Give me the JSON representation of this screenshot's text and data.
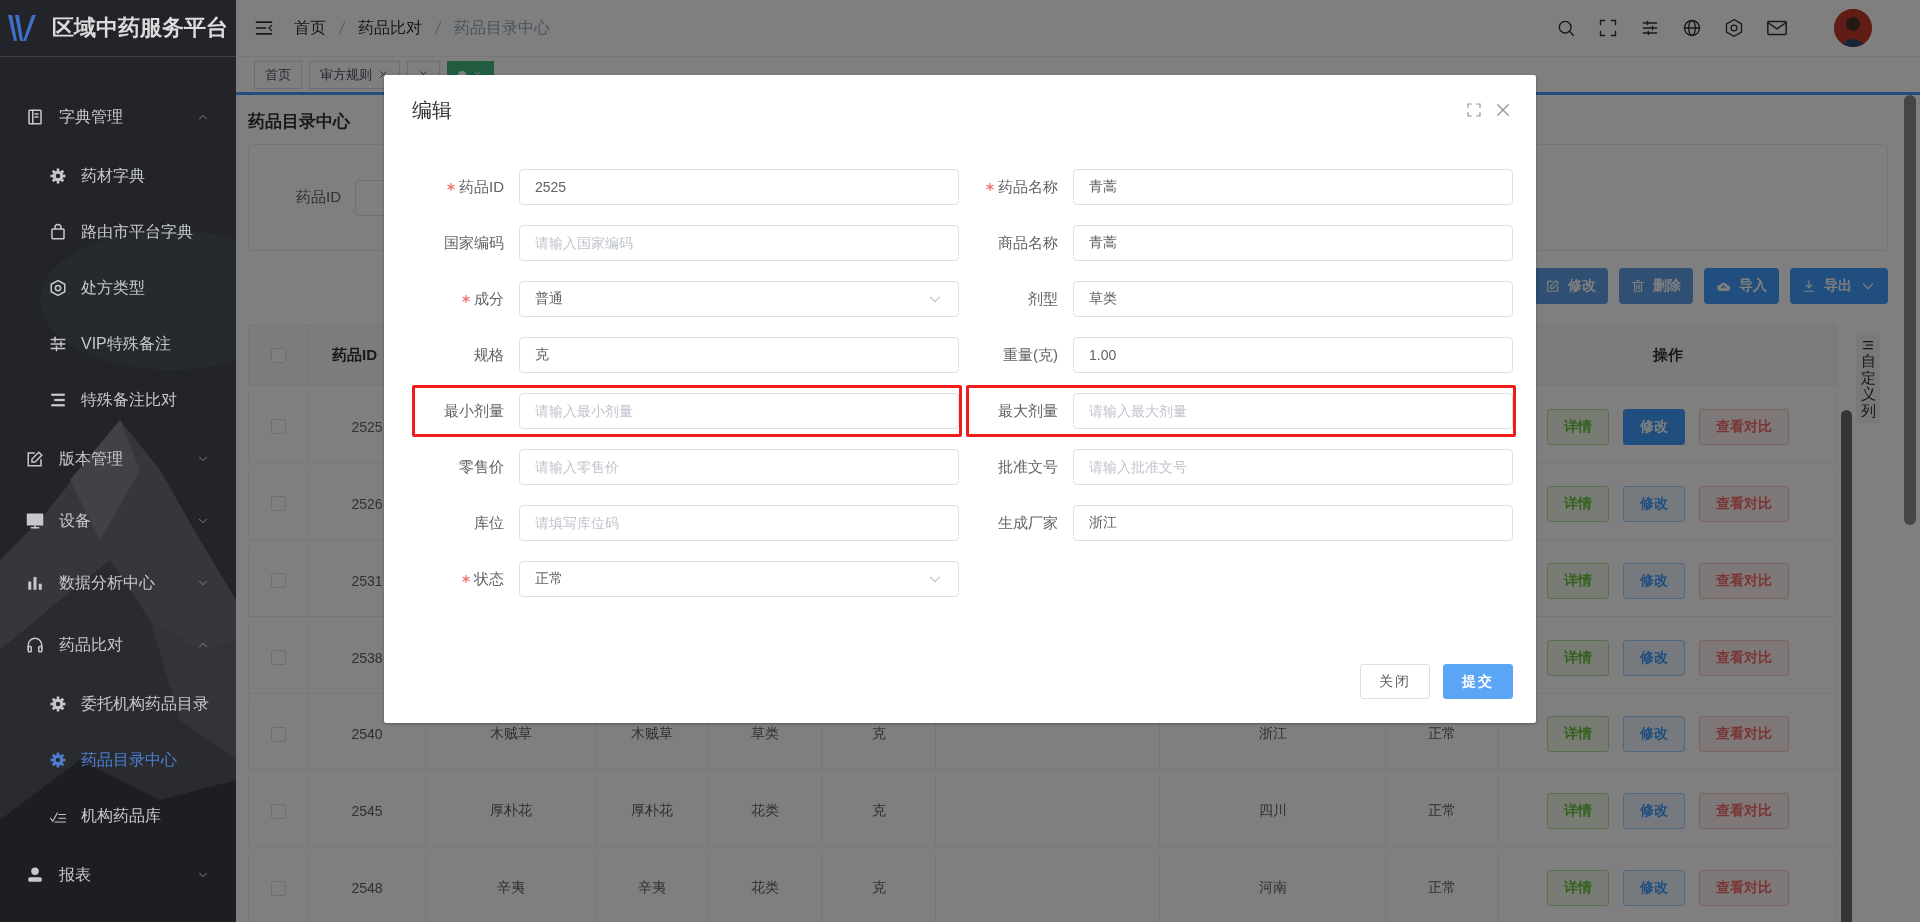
{
  "sidebar": {
    "title": "区域中药服务平台",
    "items": [
      {
        "label": "字典管理",
        "expanded": true,
        "selected": false,
        "children": [
          {
            "label": "药材字典",
            "selected": false
          },
          {
            "label": "路由市平台字典",
            "selected": false
          },
          {
            "label": "处方类型",
            "selected": false
          },
          {
            "label": "VIP特殊备注",
            "selected": false
          },
          {
            "label": "特殊备注比对",
            "selected": false
          }
        ]
      },
      {
        "label": "版本管理",
        "expanded": false,
        "selected": false
      },
      {
        "label": "设备",
        "expanded": false,
        "selected": false
      },
      {
        "label": "数据分析中心",
        "expanded": false,
        "selected": false
      },
      {
        "label": "药品比对",
        "expanded": true,
        "selected": false,
        "children": [
          {
            "label": "委托机构药品目录",
            "selected": false
          },
          {
            "label": "药品目录中心",
            "selected": true
          },
          {
            "label": "机构药品库",
            "selected": false
          }
        ]
      },
      {
        "label": "报表",
        "expanded": false,
        "selected": false
      }
    ]
  },
  "breadcrumb": [
    "首页",
    "药品比对",
    "药品目录中心"
  ],
  "tabs": [
    {
      "label": "首页",
      "selected": false,
      "closable": false
    },
    {
      "label": "审方规则",
      "selected": false,
      "closable": true
    },
    {
      "selected": false,
      "closable": true
    },
    {
      "selected": true,
      "closable": true
    }
  ],
  "page": {
    "title": "药品目录中心",
    "search": {
      "label": "药品ID"
    },
    "toolbar": [
      {
        "label": "修改",
        "kind": "edit",
        "disabled": true
      },
      {
        "label": "删除",
        "kind": "delete",
        "disabled": true
      },
      {
        "label": "导入",
        "kind": "import",
        "disabled": false
      },
      {
        "label": "导出",
        "kind": "export",
        "disabled": false
      }
    ],
    "table": {
      "all_checked": false,
      "columns": [
        "药品ID",
        "操作"
      ],
      "column_settings": "自定义列",
      "rows": [
        {
          "id": "2525",
          "checked": false,
          "actions": [
            {
              "label": "详情",
              "kind": "detail"
            },
            {
              "label": "修改",
              "kind": "edit",
              "active": true
            },
            {
              "label": "查看对比",
              "kind": "compare"
            }
          ]
        },
        {
          "id": "2526",
          "checked": false,
          "actions": [
            {
              "label": "详情",
              "kind": "detail"
            },
            {
              "label": "修改",
              "kind": "edit",
              "active": false
            },
            {
              "label": "查看对比",
              "kind": "compare"
            }
          ]
        },
        {
          "id": "2531",
          "checked": false,
          "actions": [
            {
              "label": "详情",
              "kind": "detail"
            },
            {
              "label": "修改",
              "kind": "edit",
              "active": false
            },
            {
              "label": "查看对比",
              "kind": "compare"
            }
          ]
        },
        {
          "id": "2538",
          "checked": false,
          "actions": [
            {
              "label": "详情",
              "kind": "detail"
            },
            {
              "label": "修改",
              "kind": "edit",
              "active": false
            },
            {
              "label": "查看对比",
              "kind": "compare"
            }
          ]
        },
        {
          "id": "2540",
          "name": "木贼草",
          "trade_name": "木贼草",
          "form": "草类",
          "spec": "克",
          "producer": "浙江",
          "status": "正常",
          "checked": false,
          "actions": [
            {
              "label": "详情",
              "kind": "detail"
            },
            {
              "label": "修改",
              "kind": "edit",
              "active": false
            },
            {
              "label": "查看对比",
              "kind": "compare"
            }
          ]
        },
        {
          "id": "2545",
          "name": "厚朴花",
          "trade_name": "厚朴花",
          "form": "花类",
          "spec": "克",
          "producer": "四川",
          "status": "正常",
          "checked": false,
          "actions": [
            {
              "label": "详情",
              "kind": "detail"
            },
            {
              "label": "修改",
              "kind": "edit",
              "active": false
            },
            {
              "label": "查看对比",
              "kind": "compare"
            }
          ]
        },
        {
          "id": "2548",
          "name": "辛夷",
          "trade_name": "辛夷",
          "form": "花类",
          "spec": "克",
          "producer": "河南",
          "status": "正常",
          "checked": false,
          "actions": [
            {
              "label": "详情",
              "kind": "detail"
            },
            {
              "label": "修改",
              "kind": "edit",
              "active": false
            },
            {
              "label": "查看对比",
              "kind": "compare"
            }
          ]
        }
      ]
    }
  },
  "dialog": {
    "title": "编辑",
    "fields": [
      {
        "label": "药品ID",
        "kind": "input",
        "required": true,
        "value": "2525",
        "highlighted": false
      },
      {
        "label": "药品名称",
        "kind": "input",
        "required": true,
        "value": "青蒿",
        "highlighted": false
      },
      {
        "label": "国家编码",
        "kind": "input",
        "required": false,
        "placeholder": "请输入国家编码",
        "highlighted": false
      },
      {
        "label": "商品名称",
        "kind": "input",
        "required": false,
        "value": "青蒿",
        "highlighted": false
      },
      {
        "label": "成分",
        "kind": "select",
        "required": true,
        "value": "普通",
        "highlighted": false
      },
      {
        "label": "剂型",
        "kind": "input",
        "required": false,
        "value": "草类",
        "highlighted": false
      },
      {
        "label": "规格",
        "kind": "input",
        "required": false,
        "value": "克",
        "highlighted": false
      },
      {
        "label": "重量(克)",
        "kind": "input",
        "required": false,
        "value": "1.00",
        "highlighted": false
      },
      {
        "label": "最小剂量",
        "kind": "input",
        "required": false,
        "placeholder": "请输入最小剂量",
        "highlighted": true
      },
      {
        "label": "最大剂量",
        "kind": "input",
        "required": false,
        "placeholder": "请输入最大剂量",
        "highlighted": true
      },
      {
        "label": "零售价",
        "kind": "input",
        "required": false,
        "placeholder": "请输入零售价",
        "highlighted": false
      },
      {
        "label": "批准文号",
        "kind": "input",
        "required": false,
        "placeholder": "请输入批准文号",
        "highlighted": false
      },
      {
        "label": "库位",
        "kind": "input",
        "required": false,
        "placeholder": "请填写库位码",
        "highlighted": false
      },
      {
        "label": "生成厂家",
        "kind": "input",
        "required": false,
        "value": "浙江",
        "highlighted": false
      },
      {
        "label": "状态",
        "kind": "select",
        "required": true,
        "value": "正常",
        "highlighted": false
      }
    ],
    "buttons": [
      {
        "label": "关闭",
        "kind": "default"
      },
      {
        "label": "提交",
        "kind": "primary"
      }
    ]
  }
}
